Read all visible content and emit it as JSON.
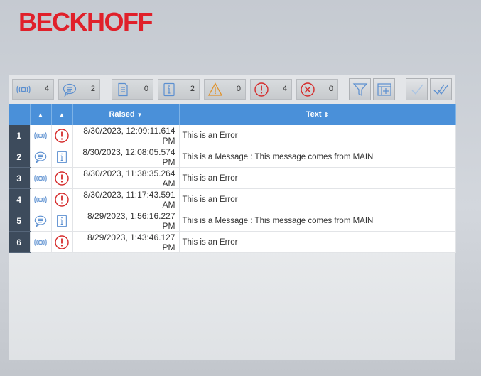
{
  "brand": {
    "logo_text": "BECKHOFF",
    "color": "#e0202a"
  },
  "toolbar": {
    "counters": [
      {
        "name": "alarm-counter",
        "icon": "alarm-icon",
        "count": "4"
      },
      {
        "name": "message-counter",
        "icon": "message-bubble-icon",
        "count": "2"
      },
      {
        "name": "document-counter",
        "icon": "document-icon",
        "count": "0"
      },
      {
        "name": "info-counter",
        "icon": "info-icon",
        "count": "2"
      },
      {
        "name": "warning-counter",
        "icon": "warning-icon",
        "count": "0"
      },
      {
        "name": "error-counter",
        "icon": "error-icon",
        "count": "4"
      },
      {
        "name": "critical-counter",
        "icon": "critical-icon",
        "count": "0"
      }
    ],
    "buttons": [
      "filter-icon",
      "columns-icon",
      "confirm-icon",
      "confirm-all-icon"
    ]
  },
  "grid": {
    "columns": [
      {
        "key": "row",
        "label": ""
      },
      {
        "key": "type",
        "label": ""
      },
      {
        "key": "severity",
        "label": ""
      },
      {
        "key": "raised",
        "label": "Raised"
      },
      {
        "key": "text",
        "label": "Text"
      }
    ],
    "header_color": "#4a90d9",
    "rows": [
      {
        "num": "1",
        "type": "alarm-icon",
        "severity": "error-icon",
        "raised": "8/30/2023, 12:09:11.614 PM",
        "text": "This is an Error"
      },
      {
        "num": "2",
        "type": "message-bubble-icon",
        "severity": "info-icon",
        "raised": "8/30/2023, 12:08:05.574 PM",
        "text": "This is a Message : This message comes from MAIN"
      },
      {
        "num": "3",
        "type": "alarm-icon",
        "severity": "error-icon",
        "raised": "8/30/2023, 11:38:35.264 AM",
        "text": "This is an Error"
      },
      {
        "num": "4",
        "type": "alarm-icon",
        "severity": "error-icon",
        "raised": "8/30/2023, 11:17:43.591 AM",
        "text": "This is an Error"
      },
      {
        "num": "5",
        "type": "message-bubble-icon",
        "severity": "info-icon",
        "raised": "8/29/2023, 1:56:16.227 PM",
        "text": "This is a Message : This message comes from MAIN"
      },
      {
        "num": "6",
        "type": "alarm-icon",
        "severity": "error-icon",
        "raised": "8/29/2023, 1:43:46.127 PM",
        "text": "This is an Error"
      }
    ]
  }
}
